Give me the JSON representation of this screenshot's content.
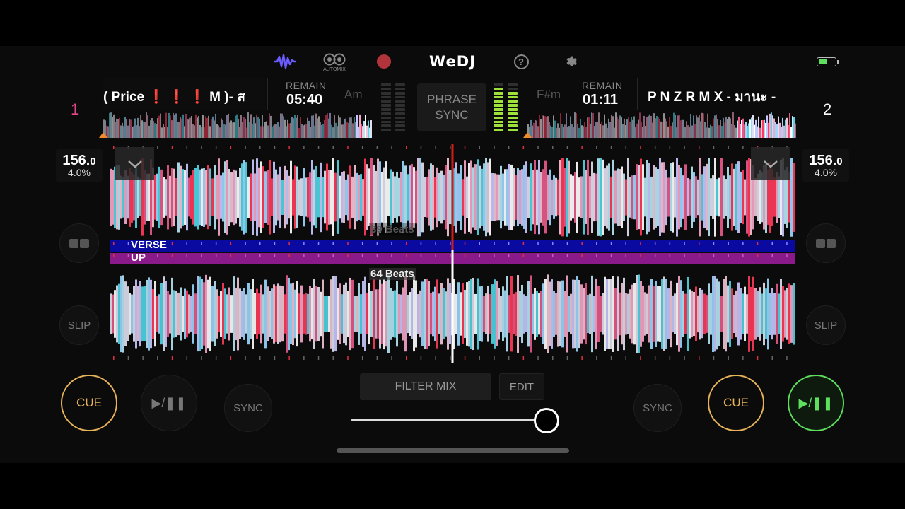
{
  "app": {
    "logo": "WeDJ"
  },
  "toolbar": {
    "automix_label": "AUTOMIX",
    "help_icon": "?",
    "icons": [
      "waveform-icon",
      "automix-icon",
      "record-icon",
      "help-icon",
      "settings-icon",
      "battery-icon"
    ]
  },
  "deck1": {
    "number": "1",
    "title": "( Price ❗ ❗ ❗ M )- ส",
    "remain_label": "REMAIN",
    "remain": "05:40",
    "key": "Am",
    "bpm_main": "156.",
    "bpm_dec": "0",
    "pitch": "4.0%",
    "slip": "SLIP",
    "sync": "SYNC",
    "cue": "CUE",
    "play": "▶/❚❚"
  },
  "deck2": {
    "number": "2",
    "title": "P N Z R M X - มานะ -",
    "remain_label": "REMAIN",
    "remain": "01:11",
    "key": "F#m",
    "bpm_main": "156.",
    "bpm_dec": "0",
    "pitch": "4.0%",
    "slip": "SLIP",
    "sync": "SYNC",
    "cue": "CUE",
    "play": "▶/❚❚"
  },
  "phrase_sync": {
    "line1": "PHRASE",
    "line2": "SYNC"
  },
  "waveform": {
    "upper_beats": "39 Beats",
    "lower_beats": "64 Beats",
    "phrase_upper": "VERSE",
    "phrase_lower": "UP"
  },
  "mixer": {
    "filter_mix": "FILTER MIX",
    "edit": "EDIT",
    "crossfader_position": 0.95
  },
  "colors": {
    "cue": "#e8b45a",
    "play_active": "#5ee05e",
    "deck1_number": "#e8448a",
    "record": "#b0343a",
    "waveform_nav": "#6a5cff",
    "phrase_blue": "#0a0aa0",
    "phrase_purple": "#8a1a8a"
  }
}
